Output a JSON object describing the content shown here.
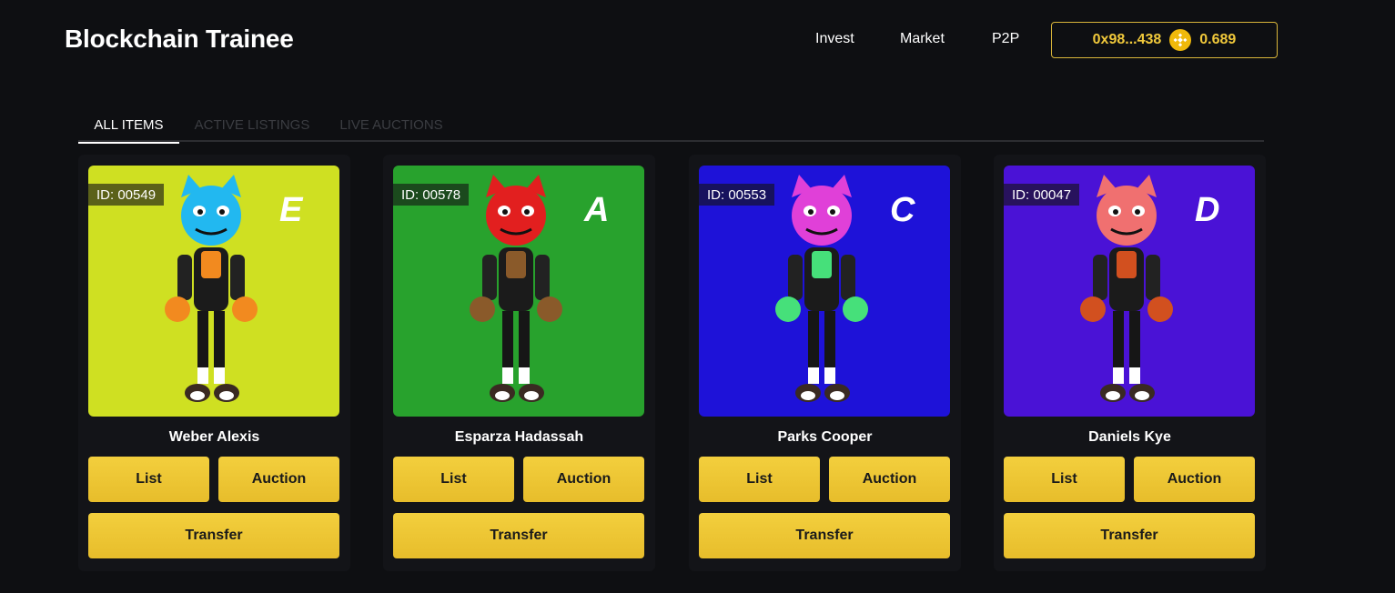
{
  "header": {
    "brand": "Blockchain Trainee",
    "nav": [
      "Invest",
      "Market",
      "P2P"
    ],
    "wallet_address": "0x98...438",
    "wallet_balance": "0.689"
  },
  "tabs": [
    {
      "label": "ALL ITEMS",
      "active": true
    },
    {
      "label": "ACTIVE LISTINGS",
      "active": false
    },
    {
      "label": "LIVE AUCTIONS",
      "active": false
    }
  ],
  "cards": [
    {
      "id_label": "ID: 00549",
      "grade": "E",
      "name": "Weber Alexis",
      "bg_color": "#cfe022",
      "head_color": "#22b8f0",
      "body_accent": "#f28a1f",
      "list_label": "List",
      "auction_label": "Auction",
      "transfer_label": "Transfer"
    },
    {
      "id_label": "ID: 00578",
      "grade": "A",
      "name": "Esparza Hadassah",
      "bg_color": "#28a22d",
      "head_color": "#e21f1f",
      "body_accent": "#8a5a2a",
      "list_label": "List",
      "auction_label": "Auction",
      "transfer_label": "Transfer"
    },
    {
      "id_label": "ID: 00553",
      "grade": "C",
      "name": "Parks Cooper",
      "bg_color": "#1e12d8",
      "head_color": "#e040d8",
      "body_accent": "#46e07a",
      "list_label": "List",
      "auction_label": "Auction",
      "transfer_label": "Transfer"
    },
    {
      "id_label": "ID: 00047",
      "grade": "D",
      "name": "Daniels Kye",
      "bg_color": "#4a12d6",
      "head_color": "#f07070",
      "body_accent": "#d2501f",
      "list_label": "List",
      "auction_label": "Auction",
      "transfer_label": "Transfer"
    }
  ],
  "colors": {
    "accent": "#f1c93b",
    "background": "#0e0f12",
    "card_background": "#131418",
    "bnb_coin": "#f0b90b"
  },
  "icons": {
    "wallet_coin": "bnb-coin-icon"
  }
}
